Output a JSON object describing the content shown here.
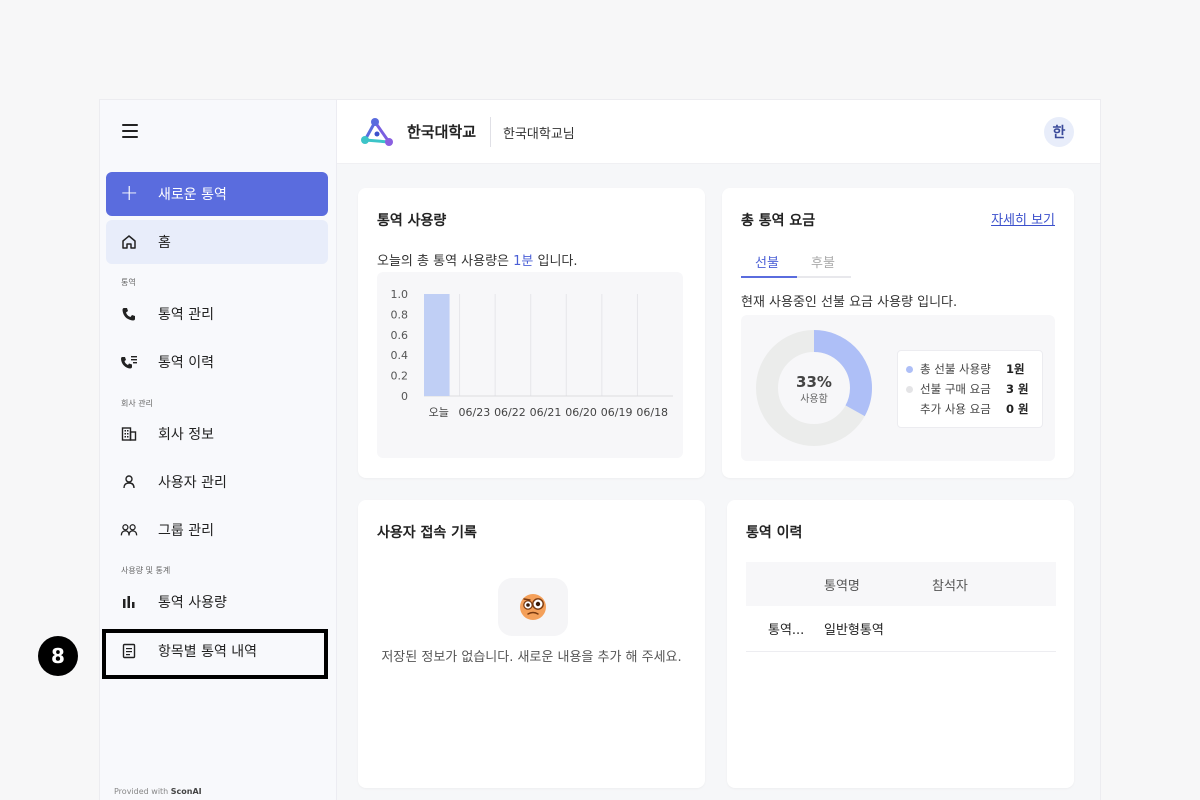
{
  "sidebar": {
    "new_button": "새로운 통역",
    "home": "홈",
    "sections": {
      "interpretation": "통역",
      "company": "회사 관리",
      "usage": "사용량 및 통계"
    },
    "items": {
      "manage": "통역 관리",
      "history": "통역 이력",
      "company_info": "회사 정보",
      "users": "사용자 관리",
      "groups": "그룹 관리",
      "usage": "통역 사용량",
      "itemized": "항목별 통역 내역"
    },
    "provided_prefix": "Provided with ",
    "provided_brand": "SconAI"
  },
  "header": {
    "org_name": "한국대학교",
    "user_name": "한국대학교님",
    "avatar": "한"
  },
  "usage_card": {
    "title": "통역 사용량",
    "desc_prefix": "오늘의 총 통역 사용량은 ",
    "desc_value": "1분",
    "desc_suffix": " 입니다."
  },
  "fee_card": {
    "title": "총 통역 요금",
    "detail_link": "자세히 보기",
    "tab_prepaid": "선불",
    "tab_postpaid": "후불",
    "desc": "현재 사용중인 선불 요금 사용량 입니다.",
    "percent": "33%",
    "percent_label": "사용함",
    "usage_fraction": 0.33,
    "legend": [
      {
        "label": "총 선불 사용량",
        "value": "1원"
      },
      {
        "label": "선불 구매 요금",
        "value": "3 원"
      },
      {
        "label": "추가 사용 요금",
        "value": "0 원"
      }
    ],
    "colors": {
      "used": "#aebff7",
      "remaining": "#ebeceb"
    }
  },
  "access_card": {
    "title": "사용자 접속 기록",
    "empty_text": "저장된 정보가 없습니다. 새로운 내용을 추가 해 주세요."
  },
  "history_card": {
    "title": "통역 이력",
    "headers": [
      "",
      "통역명",
      "참석자"
    ],
    "rows": [
      [
        "통역...",
        "일반형통역",
        ""
      ]
    ]
  },
  "chart_data": {
    "type": "bar",
    "categories": [
      "오늘",
      "06/23",
      "06/22",
      "06/21",
      "06/20",
      "06/19",
      "06/18"
    ],
    "values": [
      1,
      0,
      0,
      0,
      0,
      0,
      0
    ],
    "yticks": [
      "1.0",
      "0.8",
      "0.6",
      "0.4",
      "0.2",
      "0"
    ],
    "ylim": [
      0,
      1
    ],
    "bar_color": "#c0cff5",
    "grid": true
  },
  "annotation": {
    "badge": "8"
  }
}
